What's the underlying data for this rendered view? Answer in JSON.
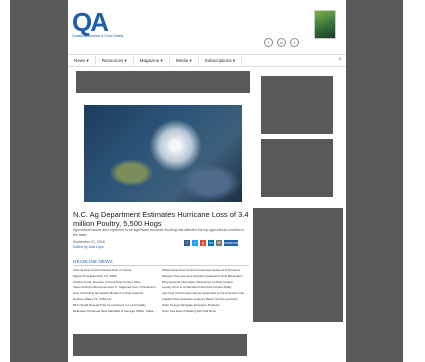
{
  "header": {
    "logo_text": "QA",
    "logo_tagline": "Quality Assurance & Food Safety",
    "social": [
      "t",
      "in",
      "f"
    ]
  },
  "nav": {
    "items": [
      "News ▾",
      "Resources ▾",
      "Magazine ▾",
      "Media ▾",
      "Subscriptions ▾"
    ],
    "search_icon": "⌕"
  },
  "article": {
    "headline": "N.C. Ag Department Estimates Hurricane Loss of 3.4 million Poultry, 5,500 Hogs",
    "summary": "Agricultural losses also expected to be significant because flooding has affected the top agricultural counties in the state.",
    "date": "September 21, 2018",
    "author": "Edited by Lisa Lupo",
    "share_icons": [
      "f",
      "t",
      "g",
      "in",
      "✉"
    ],
    "share_colors": [
      "#3b5998",
      "#1da1f2",
      "#dd4b39",
      "#0077b5",
      "#777777"
    ],
    "subscribe_label": "SUBSCRIBE"
  },
  "headline_news": {
    "label": "HEADLINE NEWS",
    "left": [
      "Arizona Pest Control Named Tech of Yousef",
      "Signed Pest Extension Inc. 5466",
      "Charles Cook, Founder of Cook Pest Control, Dies",
      "Verex Antimicrobial Announces C. Sugerred Cert. Of Antimicrobi...",
      "Pest Controlling Nematoxin Bedtons in Pest Hazards",
      "Hetzsee Wales Inc. 5466 Ltd",
      "BFi's Small Research Re-Commitment to Local Quality",
      "Rolleritee Continued New Standard of Georgia USDA, Cattle Signs"
    ],
    "right": [
      "Wheat Zone Pest Control Announces Series of Promotions",
      "Western Pest Services Acquires Quarantine Pest Elimination",
      "PCQ Extends Information Resources on Pest Control",
      "Laxony Aims to Understand New Pest Control Ability",
      "Agri-Fuel Transmission Enjoys Extended to the American Cancer I...",
      "Franklin Pest Solutions Acquires Basco Termite and Pest",
      "Pride Omega Sanigaite Emergent Products",
      "Suzo Ties Expert Dealing with Rod Drive"
    ]
  }
}
